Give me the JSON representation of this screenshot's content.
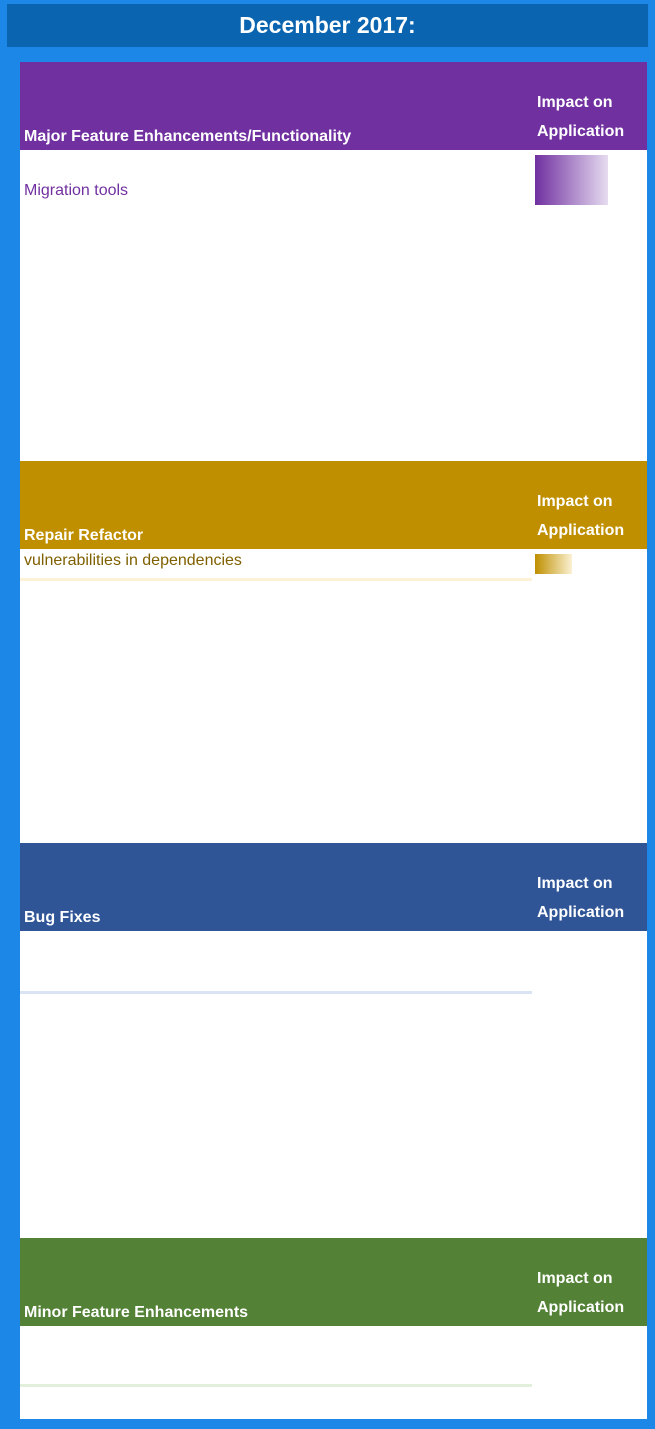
{
  "title": "December 2017:",
  "sections": [
    {
      "name": "Major Feature Enhancements/Functionality",
      "impact_label_1": "Impact on",
      "impact_label_2": "Application",
      "color": "#7030a0",
      "items": [
        {
          "text": "Migration tools"
        }
      ]
    },
    {
      "name": "Repair Refactor",
      "impact_label_1": "Impact on",
      "impact_label_2": "Application",
      "color": "#bf8f00",
      "items": [
        {
          "text": "vulnerabilities in dependencies"
        }
      ]
    },
    {
      "name": "Bug Fixes",
      "impact_label_1": "Impact on",
      "impact_label_2": "Application",
      "color": "#2f5597",
      "items": []
    },
    {
      "name": "Minor Feature Enhancements",
      "impact_label_1": "Impact on",
      "impact_label_2": "Application",
      "color": "#538135",
      "items": []
    }
  ]
}
